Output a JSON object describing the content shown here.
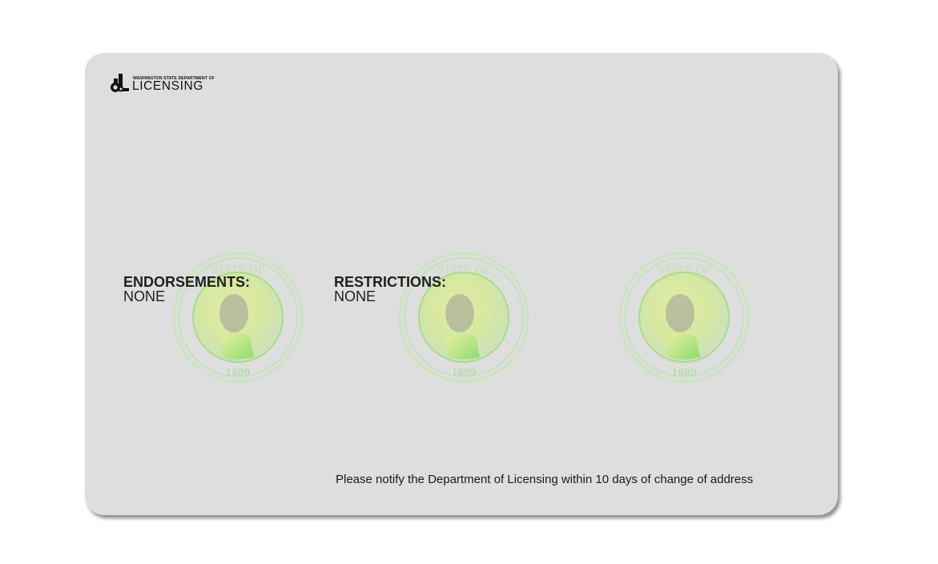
{
  "logo": {
    "small_text": "WASHINGTON STATE DEPARTMENT OF",
    "big_text": "LICENSING",
    "mark_text": "dL"
  },
  "fields": {
    "endorsements": {
      "label": "ENDORSEMENTS:",
      "value": "NONE"
    },
    "restrictions": {
      "label": "RESTRICTIONS:",
      "value": "NONE"
    }
  },
  "seal": {
    "text_top": "THE SEAL OF THE STATE OF WASHINGTON",
    "year": "1889",
    "count": 3
  },
  "notice": "Please notify the Department of Licensing within 10 days of change of address",
  "colors": {
    "card_background": "#dedede",
    "seal_green": "#8fe06a",
    "seal_yellow": "#e4ec9a",
    "text": "#1f1f1f"
  }
}
